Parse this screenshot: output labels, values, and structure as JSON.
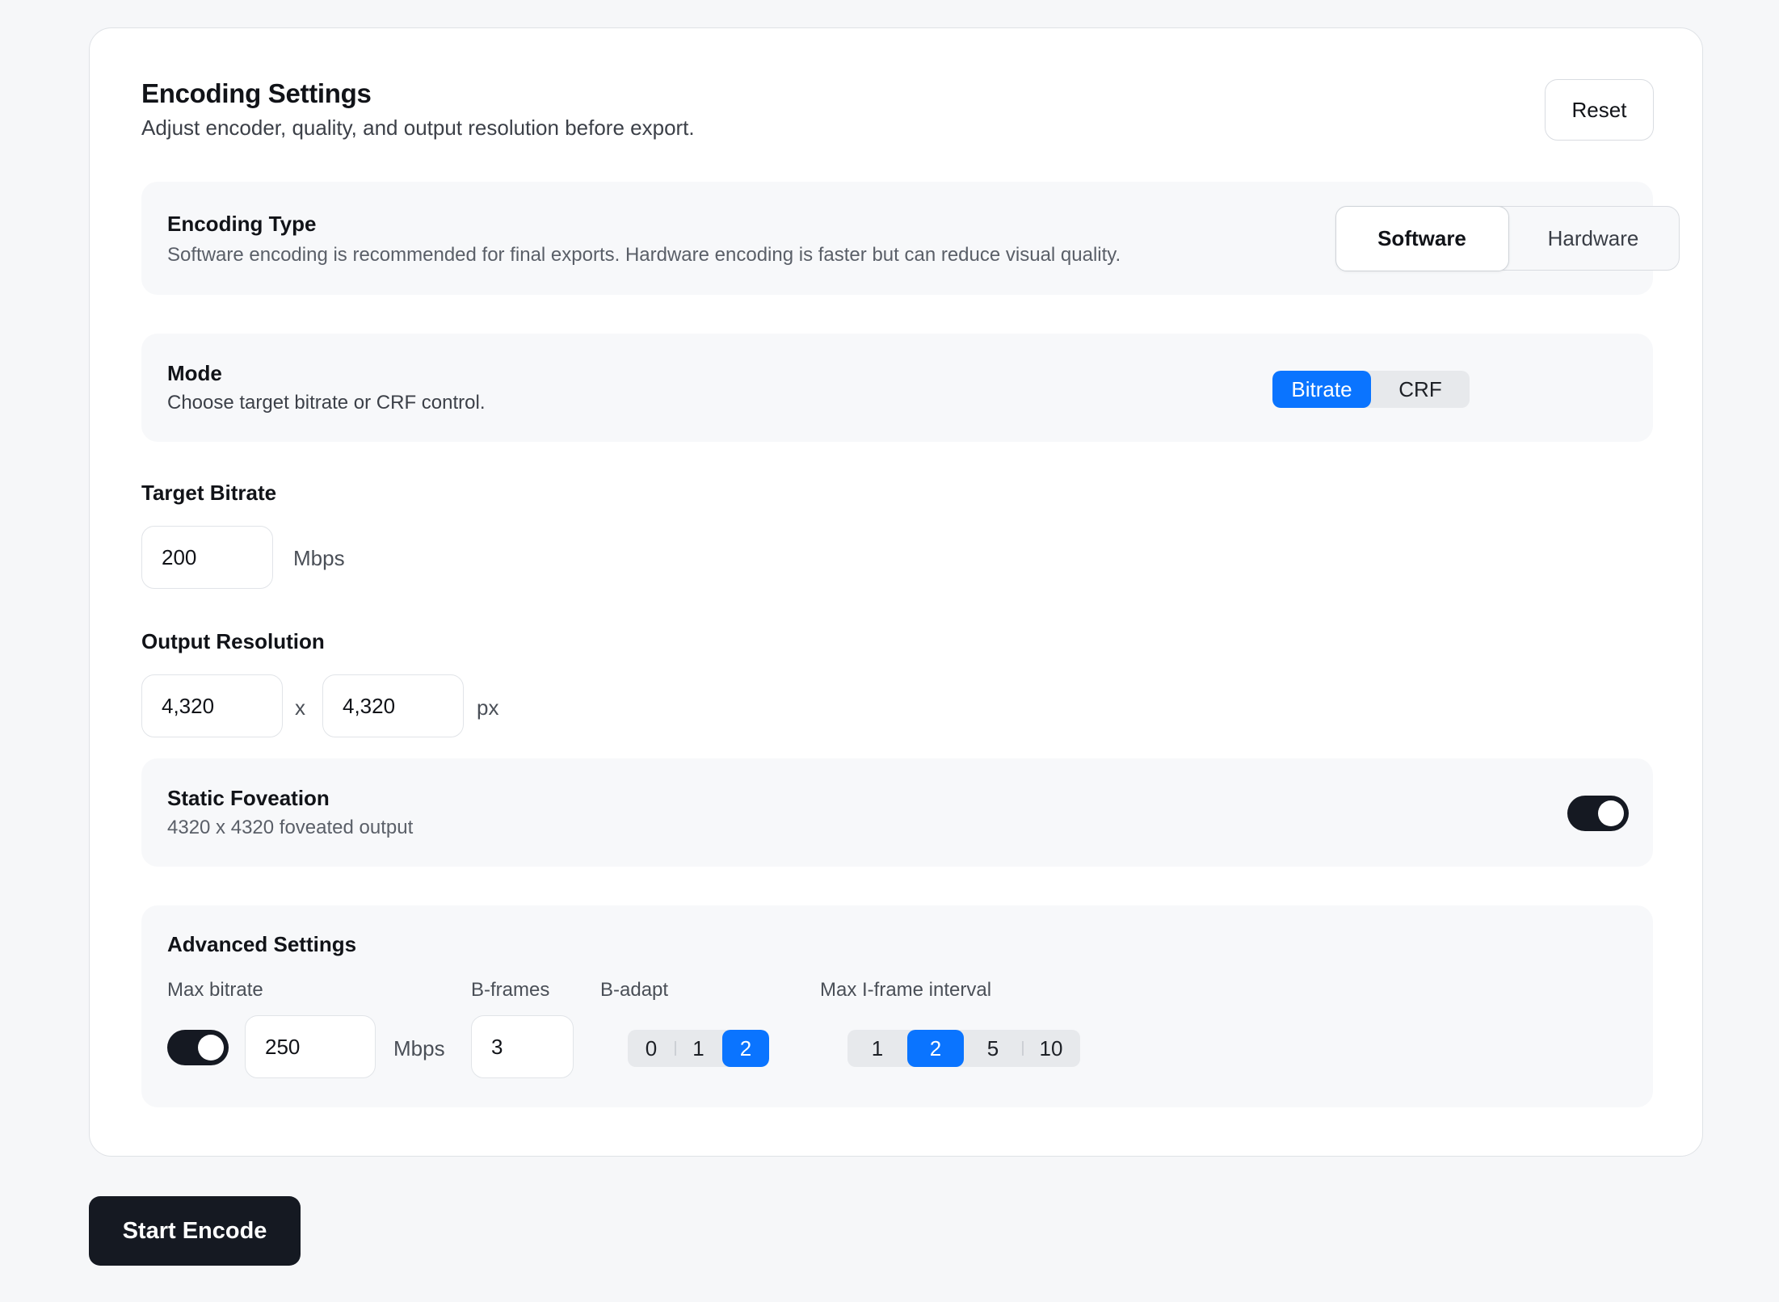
{
  "header": {
    "title": "Encoding Settings",
    "subtitle": "Adjust encoder, quality, and output resolution before export.",
    "reset_label": "Reset"
  },
  "encoding_type": {
    "title": "Encoding Type",
    "description": "Software encoding is recommended for final exports. Hardware encoding is faster but can reduce visual quality.",
    "options": [
      "Software",
      "Hardware"
    ],
    "selected": "Software"
  },
  "mode": {
    "title": "Mode",
    "description": "Choose target bitrate or CRF control.",
    "options": [
      "Bitrate",
      "CRF"
    ],
    "selected": "Bitrate"
  },
  "target_bitrate": {
    "label": "Target Bitrate",
    "value": "200",
    "unit": "Mbps"
  },
  "output_resolution": {
    "label": "Output Resolution",
    "width": "4,320",
    "separator": "x",
    "height": "4,320",
    "unit": "px"
  },
  "static_foveation": {
    "title": "Static Foveation",
    "description": "4320 x 4320 foveated output",
    "enabled": true
  },
  "advanced": {
    "title": "Advanced Settings",
    "max_bitrate_label": "Max bitrate",
    "max_bitrate_enabled": true,
    "max_bitrate_value": "250",
    "max_bitrate_unit": "Mbps",
    "b_frames_label": "B-frames",
    "b_frames_value": "3",
    "b_adapt_label": "B-adapt",
    "b_adapt_options": [
      "0",
      "1",
      "2"
    ],
    "b_adapt_selected": "2",
    "max_iframe_label": "Max I-frame interval",
    "max_iframe_options": [
      "1",
      "2",
      "5",
      "10"
    ],
    "max_iframe_selected": "2"
  },
  "footer": {
    "start_label": "Start Encode"
  },
  "colors": {
    "accent": "#0a74ff",
    "dark": "#151922",
    "background": "#f6f7f9"
  }
}
